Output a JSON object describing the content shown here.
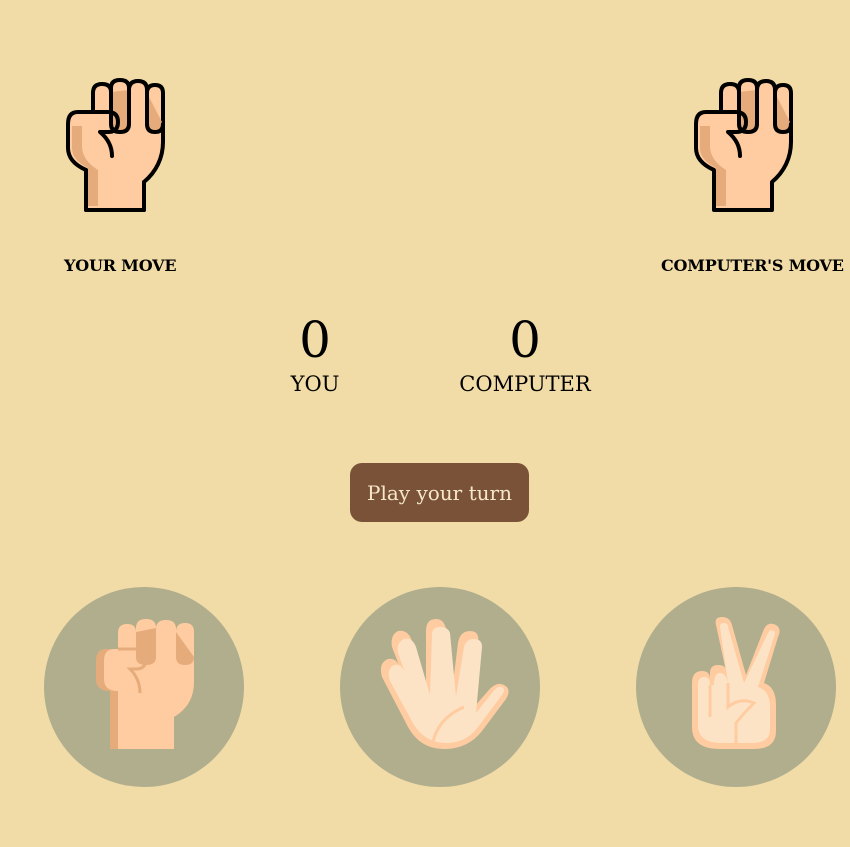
{
  "moves": {
    "your_move_label": "YOUR MOVE",
    "computer_move_label": "COMPUTER'S MOVE",
    "your_move_icon": "rock-fist-icon",
    "computer_move_icon": "rock-fist-icon"
  },
  "score": {
    "you_value": "0",
    "you_label": "YOU",
    "computer_value": "0",
    "computer_label": "COMPUTER"
  },
  "play_button_label": "Play your turn",
  "choices": [
    {
      "name": "rock",
      "icon": "rock-fist-icon"
    },
    {
      "name": "paper",
      "icon": "paper-hand-icon"
    },
    {
      "name": "scissors",
      "icon": "scissors-hand-icon"
    }
  ],
  "colors": {
    "background": "#f1dca7",
    "button": "#7a5237",
    "button_text": "#f6e7c8",
    "choice_circle": "#b1ae8e",
    "skin": "#fecca0",
    "skin_shadow": "#e6ab7a",
    "skin_light": "#fde3c6"
  }
}
